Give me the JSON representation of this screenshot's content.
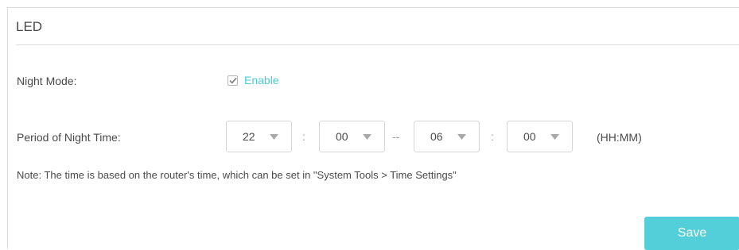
{
  "section": {
    "title": "LED"
  },
  "night_mode": {
    "label": "Night Mode:",
    "enabled": true,
    "enable_label": "Enable"
  },
  "period": {
    "label": "Period of Night Time:",
    "start_hour": "22",
    "start_minute": "00",
    "end_hour": "06",
    "end_minute": "00",
    "time_separator": ":",
    "range_separator": "--",
    "format_hint": "(HH:MM)"
  },
  "note": "Note: The time is based on the router's time, which can be set in \"System Tools > Time Settings\"",
  "actions": {
    "save_label": "Save"
  },
  "colors": {
    "accent": "#4acbd6",
    "save_button": "#52cfd8"
  },
  "icons": {
    "checkbox": "check-icon",
    "dropdown": "caret-down-icon"
  }
}
